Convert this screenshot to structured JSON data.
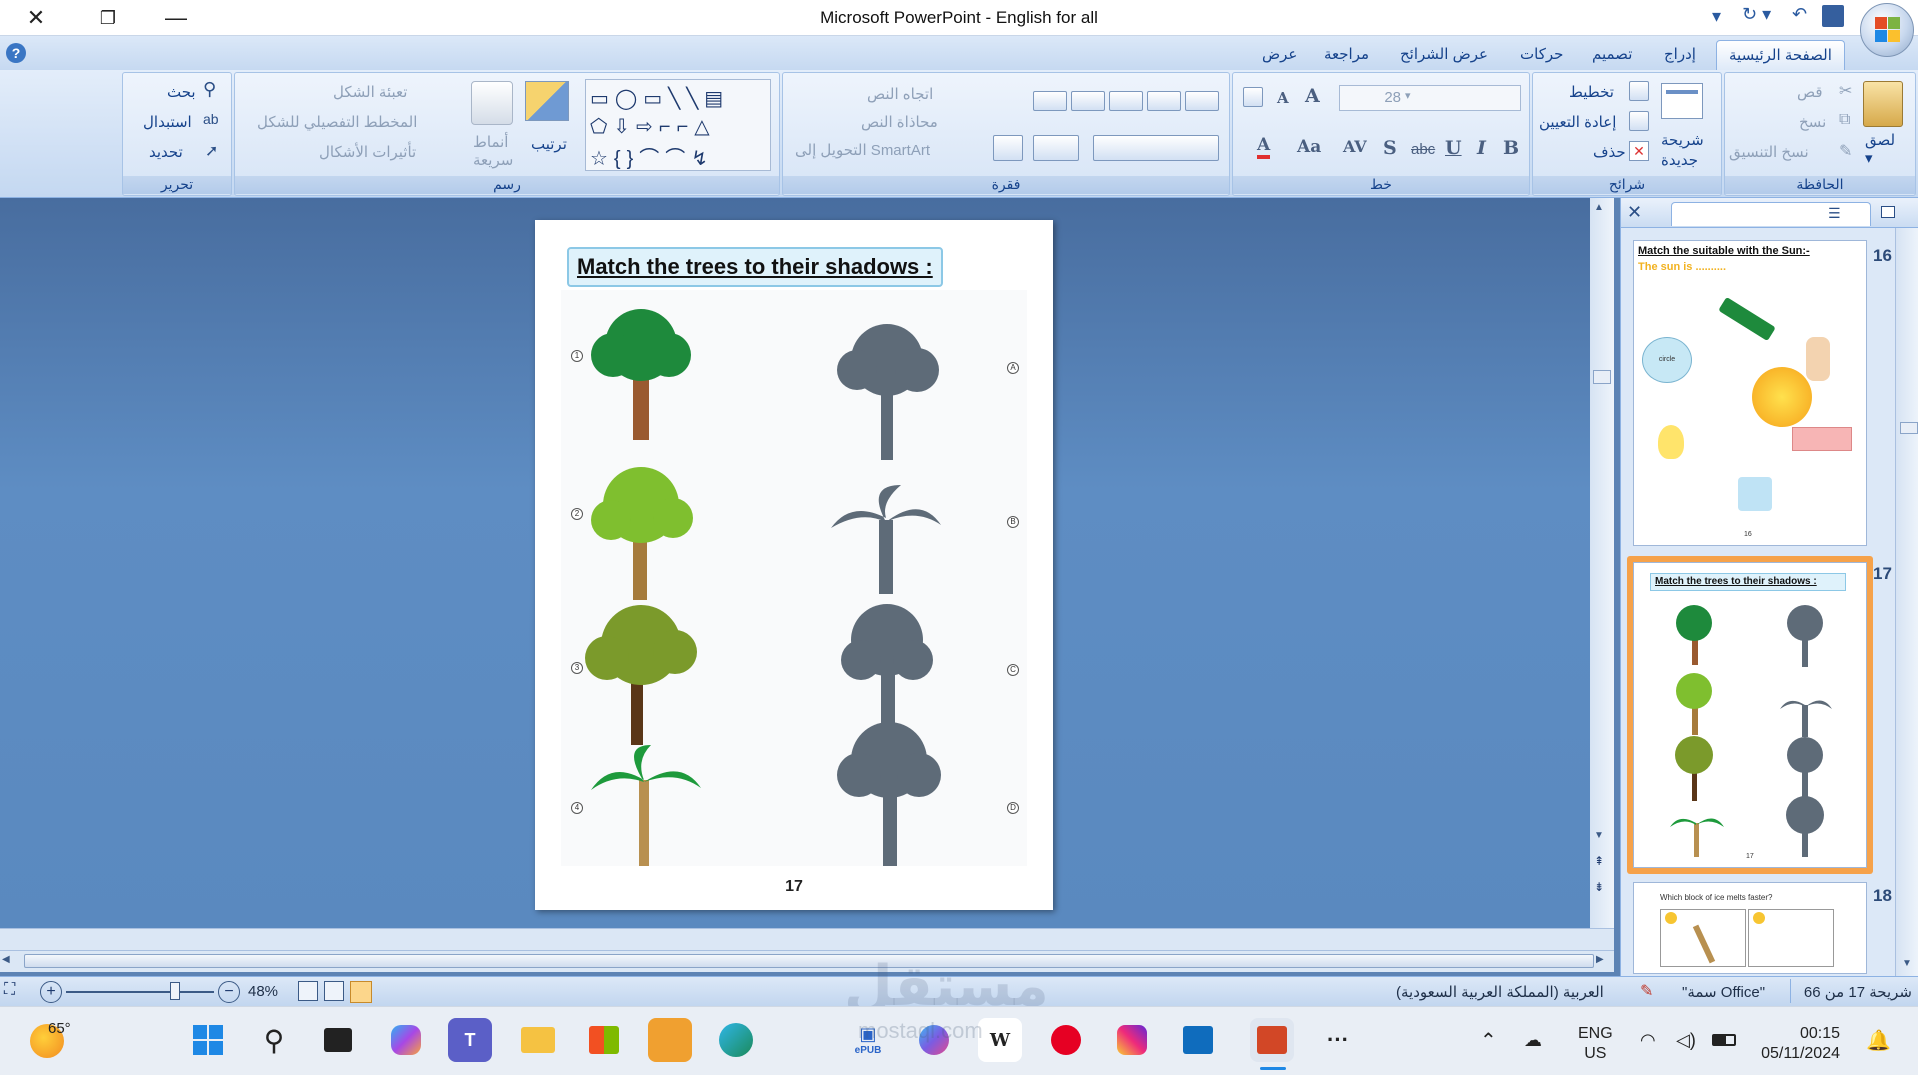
{
  "window": {
    "title": "Microsoft PowerPoint - English for all"
  },
  "tabs": [
    "الصفحة الرئيسية",
    "إدراج",
    "تصميم",
    "حركات",
    "عرض الشرائح",
    "مراجعة",
    "عرض"
  ],
  "ribbon": {
    "clipboard": {
      "label": "الحافظة",
      "paste": "لصق",
      "cut": "قص",
      "copy": "نسخ",
      "format_painter": "نسخ التنسيق"
    },
    "slides": {
      "label": "شرائح",
      "new_slide_1": "شريحة",
      "new_slide_2": "جديدة",
      "layout": "تخطيط",
      "reset": "إعادة التعيين",
      "delete": "حذف"
    },
    "font": {
      "label": "خط",
      "size": "28",
      "bold": "B",
      "italic": "I",
      "underline": "U",
      "strike": "abc",
      "shadow": "S",
      "spacing": "AV",
      "case": "Aa",
      "color": "A",
      "grow": "A",
      "shrink": "A"
    },
    "paragraph": {
      "label": "فقرة",
      "text_direction": "اتجاه النص",
      "align_text": "محاذاة النص",
      "smartart": "التحويل إلى SmartArt"
    },
    "drawing": {
      "label": "رسم",
      "arrange": "ترتيب",
      "quick_styles_1": "أنماط",
      "quick_styles_2": "سريعة",
      "shape_fill": "تعبئة الشكل",
      "shape_outline": "المخطط التفصيلي للشكل",
      "shape_effects": "تأثيرات الأشكال"
    },
    "editing": {
      "label": "تحرير",
      "find": "بحث",
      "replace": "استبدال",
      "select": "تحديد"
    }
  },
  "slide": {
    "title": "Match the trees to their shadows :",
    "number": "17",
    "left_labels": [
      "1",
      "2",
      "3",
      "4"
    ],
    "right_labels": [
      "A",
      "B",
      "C",
      "D"
    ]
  },
  "thumbnails": [
    {
      "num": "16",
      "title": "Match the suitable with the Sun:-",
      "subtitle": "The sun is ..........",
      "circle_text": "circle",
      "footer": "16"
    },
    {
      "num": "17",
      "title": "Match the trees to their shadows :",
      "footer": "17"
    },
    {
      "num": "18",
      "title": "Which block of ice melts faster?"
    }
  ],
  "status": {
    "slide_info": "شريحة 17 من 66",
    "theme": "\"سمة Office\"",
    "language": "العربية (المملكة العربية السعودية)",
    "zoom": "48%"
  },
  "taskbar": {
    "weather": "65°",
    "lang_1": "ENG",
    "lang_2": "US",
    "time": "00:15",
    "date": "05/11/2024",
    "word_icon": "W",
    "teams_icon": "T",
    "epub_label": "ePUB",
    "more": "···"
  },
  "watermark": {
    "text": "مستقل",
    "url": "mostaql.com"
  },
  "colors": {
    "accent": "#15428b",
    "ribbon_bg": "#dbe8f8",
    "workspace": "#5c83b4",
    "selected_thumb": "#f6a24a"
  }
}
